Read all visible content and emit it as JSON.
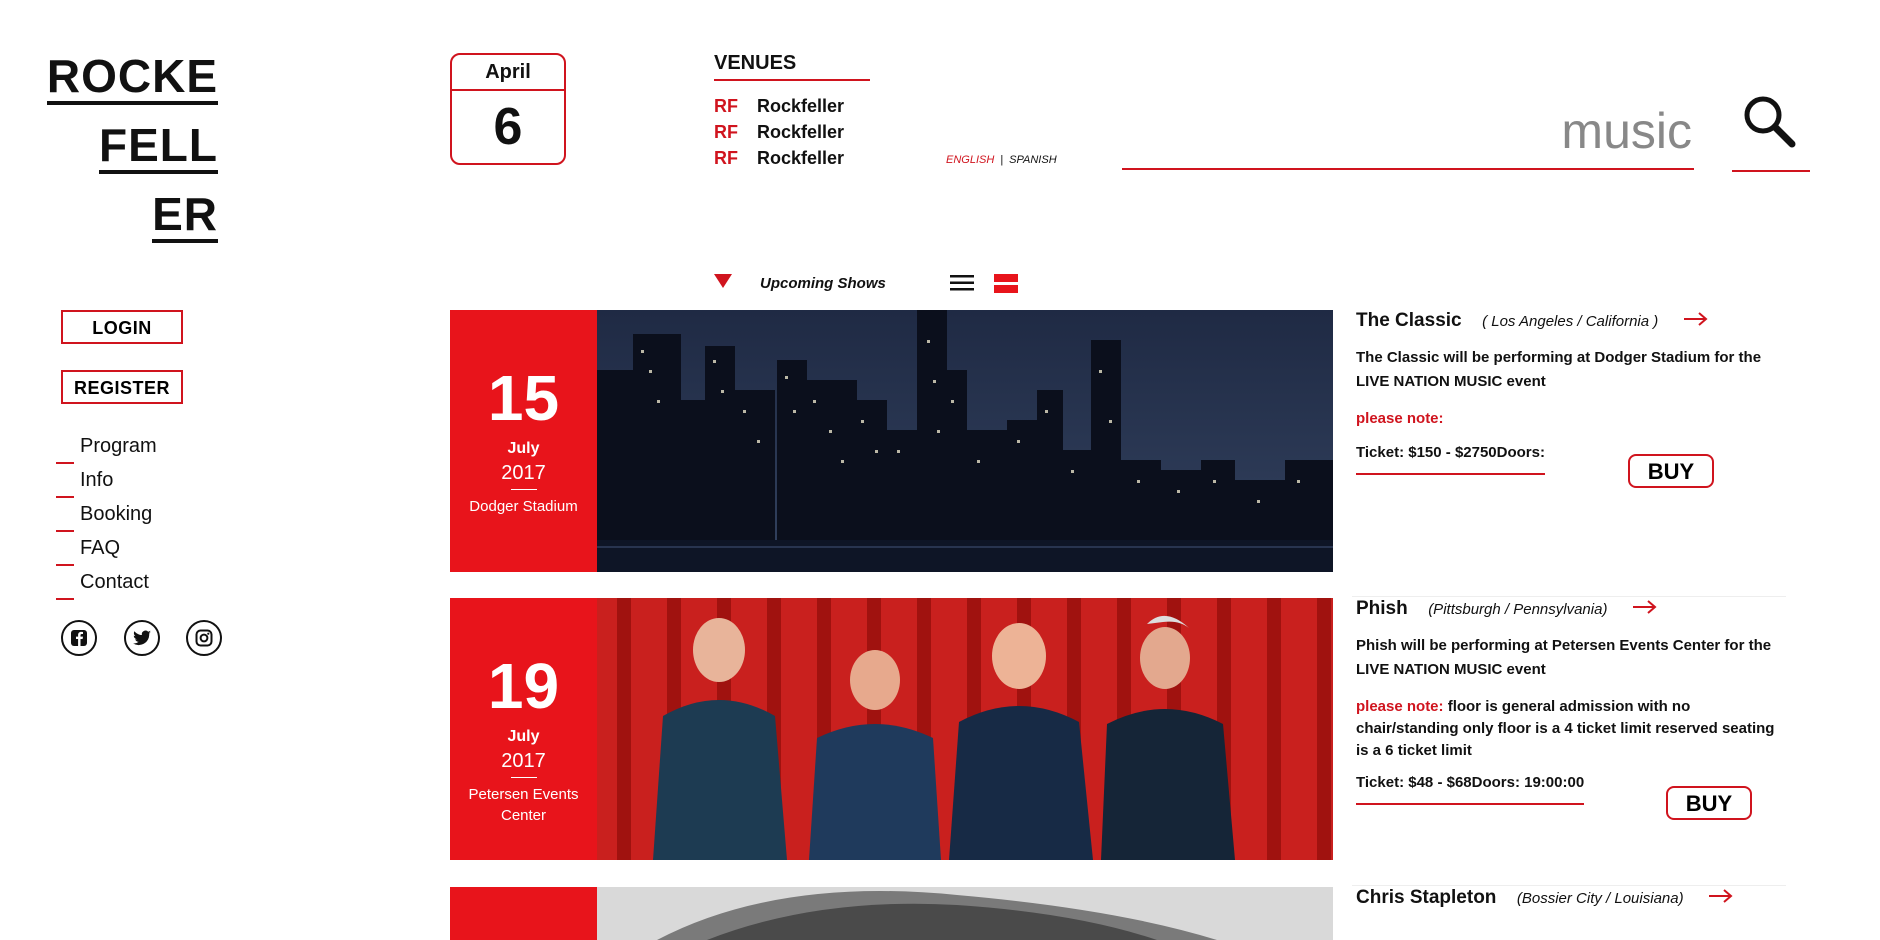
{
  "logo": {
    "lines": [
      "ROCKE",
      "FELL",
      "ER"
    ]
  },
  "date": {
    "month": "April",
    "day": "6"
  },
  "venues": {
    "title": "VENUES",
    "items": [
      {
        "tag": "RF",
        "name": "Rockfeller"
      },
      {
        "tag": "RF",
        "name": "Rockfeller"
      },
      {
        "tag": "RF",
        "name": "Rockfeller"
      }
    ]
  },
  "language": {
    "english": "ENGLISH",
    "separator": "|",
    "spanish": "SPANISH"
  },
  "search": {
    "value": "music",
    "icon": "search-icon"
  },
  "toolbar": {
    "label": "Upcoming Shows"
  },
  "auth": {
    "login": "LOGIN",
    "register": "REGISTER"
  },
  "nav": {
    "items": [
      "Program",
      "Info",
      "Booking",
      "FAQ",
      "Contact"
    ]
  },
  "social": [
    "facebook-icon",
    "twitter-icon",
    "instagram-icon"
  ],
  "colors": {
    "accent": "#d0141e",
    "date_bg": "#e8141b"
  },
  "events": [
    {
      "day": "15",
      "month": "July",
      "year": "2017",
      "venue": "Dodger Stadium",
      "title": "The Classic",
      "location": "( Los Angeles / California )",
      "description": "The Classic will be performing at Dodger Stadium for the LIVE NATION MUSIC event",
      "note_label": "please note:",
      "note_text": "",
      "ticket": "Ticket: $150 - $2750Doors:",
      "buy": "BUY"
    },
    {
      "day": "19",
      "month": "July",
      "year": "2017",
      "venue": "Petersen Events Center",
      "title": "Phish",
      "location": "(Pittsburgh / Pennsylvania)",
      "description": "Phish will be performing at Petersen Events Center for the LIVE NATION MUSIC event",
      "note_label": "please note:",
      "note_text": " floor is general admission with no chair/standing only floor is a 4 ticket limit reserved seating is a 6 ticket limit",
      "ticket": "Ticket: $48 - $68Doors: 19:00:00",
      "buy": "BUY"
    },
    {
      "title": "Chris Stapleton",
      "location": "(Bossier City / Louisiana)"
    }
  ]
}
